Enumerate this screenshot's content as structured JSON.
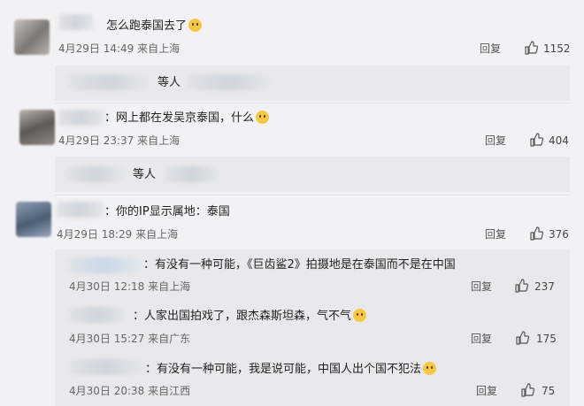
{
  "comments": [
    {
      "text": "怎么跑泰国去了",
      "time": "4月29日 14:49",
      "location": "来自上海",
      "reply": "回复",
      "likes": "1152",
      "emoji": "doge-emoji"
    },
    {
      "prefix": "：",
      "text": "网上都在发吴京泰国，什么",
      "time": "4月29日 23:37",
      "location": "来自上海",
      "reply": "回复",
      "likes": "404",
      "emoji": "doge-emoji"
    },
    {
      "prefix": "：",
      "text": "你的IP显示属地：泰国",
      "time": "4月29日 18:29",
      "location": "来自上海",
      "reply": "回复",
      "likes": "376"
    }
  ],
  "collapsed": [
    {
      "text": "等人"
    },
    {
      "text": "等人"
    }
  ],
  "replies": [
    {
      "prefix": "：",
      "text": "有没有一种可能，《巨齿鲨2》拍摄地是在泰国而不是在中国",
      "time": "4月30日 12:18",
      "location": "来自上海",
      "reply": "回复",
      "likes": "237"
    },
    {
      "prefix": "：",
      "text": "人家出国拍戏了，跟杰森斯坦森，气不气",
      "time": "4月30日 15:27",
      "location": "来自广东",
      "reply": "回复",
      "likes": "175",
      "emoji": "smile-emoji"
    },
    {
      "prefix": "：",
      "text": "有没有一种可能，我是说可能，中国人出个国不犯法",
      "time": "4月30日 20:38",
      "location": "来自江西",
      "reply": "回复",
      "likes": "75",
      "emoji": "smile-emoji"
    }
  ],
  "icons": {
    "like": "thumbs-up-icon"
  },
  "colors": {
    "background": "#f2f2f4",
    "reply_panel": "#e9e9ec"
  }
}
